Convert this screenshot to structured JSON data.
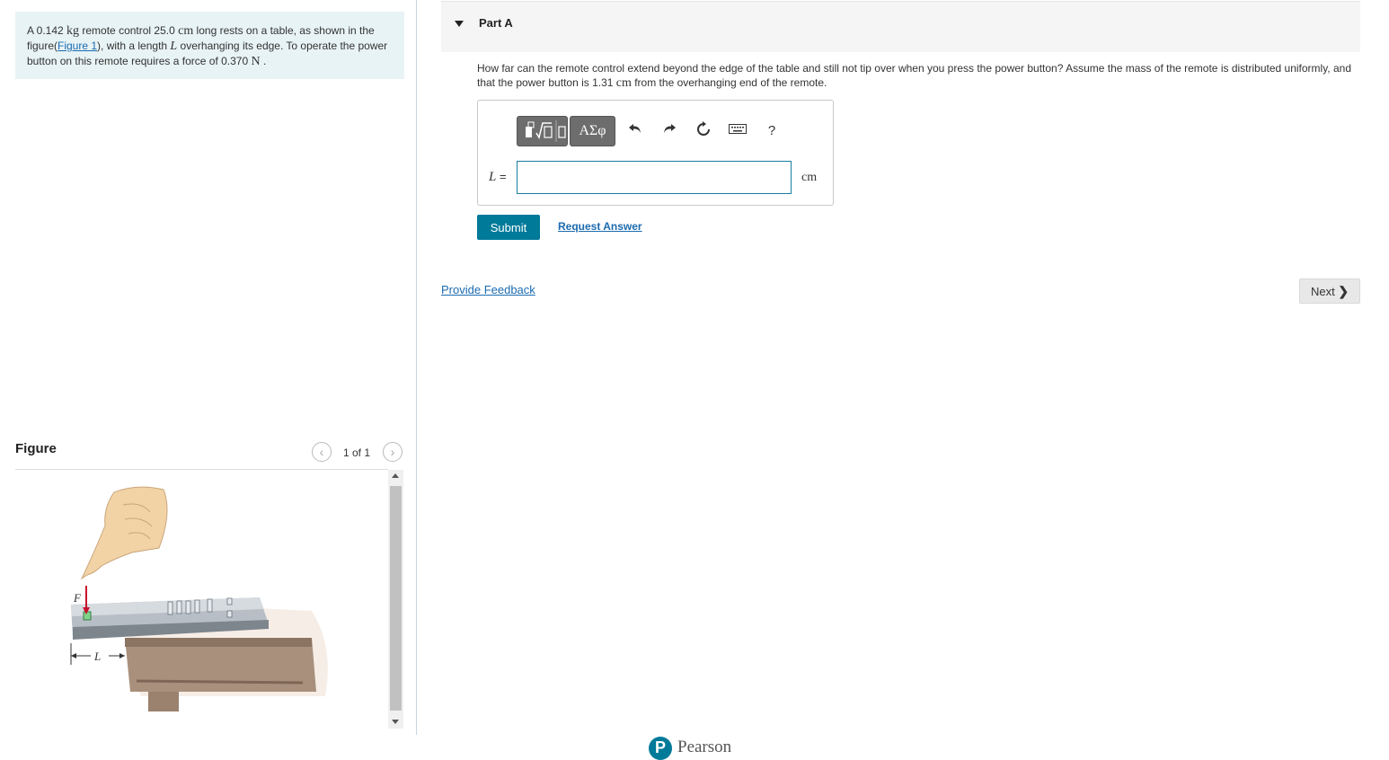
{
  "problem": {
    "t1": "A 0.142 ",
    "u_kg": "kg",
    "t2": " remote control 25.0 ",
    "u_cm": "cm",
    "t3": " long rests on a table, as shown in the figure(",
    "figure_link": "Figure 1",
    "t4": "), with a length ",
    "var_L": "L",
    "t5": " overhanging its edge. To operate the power button on this remote requires a force of 0.370 ",
    "u_N": "N",
    "t6": " ."
  },
  "figure": {
    "title": "Figure",
    "counter": "1 of 1",
    "prev_glyph": "‹",
    "next_glyph": "›",
    "label_F": "F",
    "label_L": "L"
  },
  "part": {
    "title": "Part A",
    "q1": "How far can the remote control extend beyond the edge of the table and still not tip over when you press the power button? Assume the mass of the remote is distributed uniformly, and that the power button is 1.31 ",
    "q_unit": "cm",
    "q2": " from the overhanging end of the remote."
  },
  "toolbar": {
    "greek_label": "ΑΣφ",
    "undo_icon": "undo-icon",
    "redo_icon": "redo-icon",
    "reset_icon": "reset-icon",
    "keyboard_icon": "keyboard-icon",
    "help_label": "?"
  },
  "answer": {
    "var": "L",
    "eq": " =",
    "value": "",
    "unit": "cm"
  },
  "actions": {
    "submit": "Submit",
    "request": "Request Answer",
    "feedback": "Provide Feedback",
    "next": "Next",
    "next_chevron": "❯"
  },
  "footer": {
    "logo_letter": "P",
    "brand": "Pearson"
  },
  "colors": {
    "accent": "#007a99",
    "link": "#1b6bb0",
    "problem_bg": "#e8f3f5"
  }
}
